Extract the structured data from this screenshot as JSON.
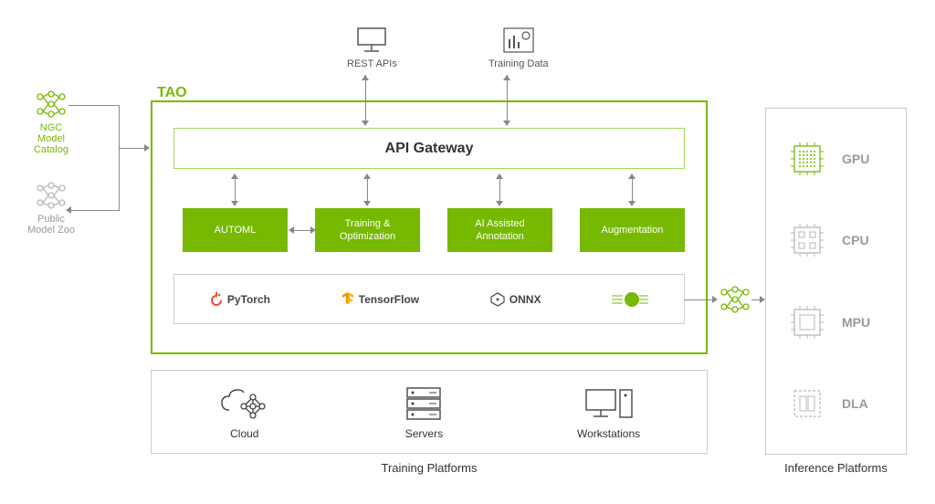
{
  "tao_title": "TAO",
  "top_inputs": {
    "rest": "REST APIs",
    "data": "Training Data"
  },
  "api_gateway": "API Gateway",
  "blocks": {
    "automl": "AUTOML",
    "train": "Training & Optimization",
    "ai": "AI Assisted Annotation",
    "aug": "Augmentation"
  },
  "frameworks": {
    "pytorch": "PyTorch",
    "tensorflow": "TensorFlow",
    "onnx": "ONNX",
    "tensorrt": "TensorRT"
  },
  "inputs_left": {
    "ngc": "NGC Model Catalog",
    "zoo": "Public Model Zoo"
  },
  "training_items": {
    "cloud": "Cloud",
    "servers": "Servers",
    "workstations": "Workstations"
  },
  "training_platforms_label": "Training Platforms",
  "inference_items": {
    "gpu": "GPU",
    "cpu": "CPU",
    "mpu": "MPU",
    "dla": "DLA"
  },
  "inference_platforms_label": "Inference Platforms",
  "colors": {
    "nvidia_green": "#76b900",
    "grey": "#9a9a9a"
  }
}
